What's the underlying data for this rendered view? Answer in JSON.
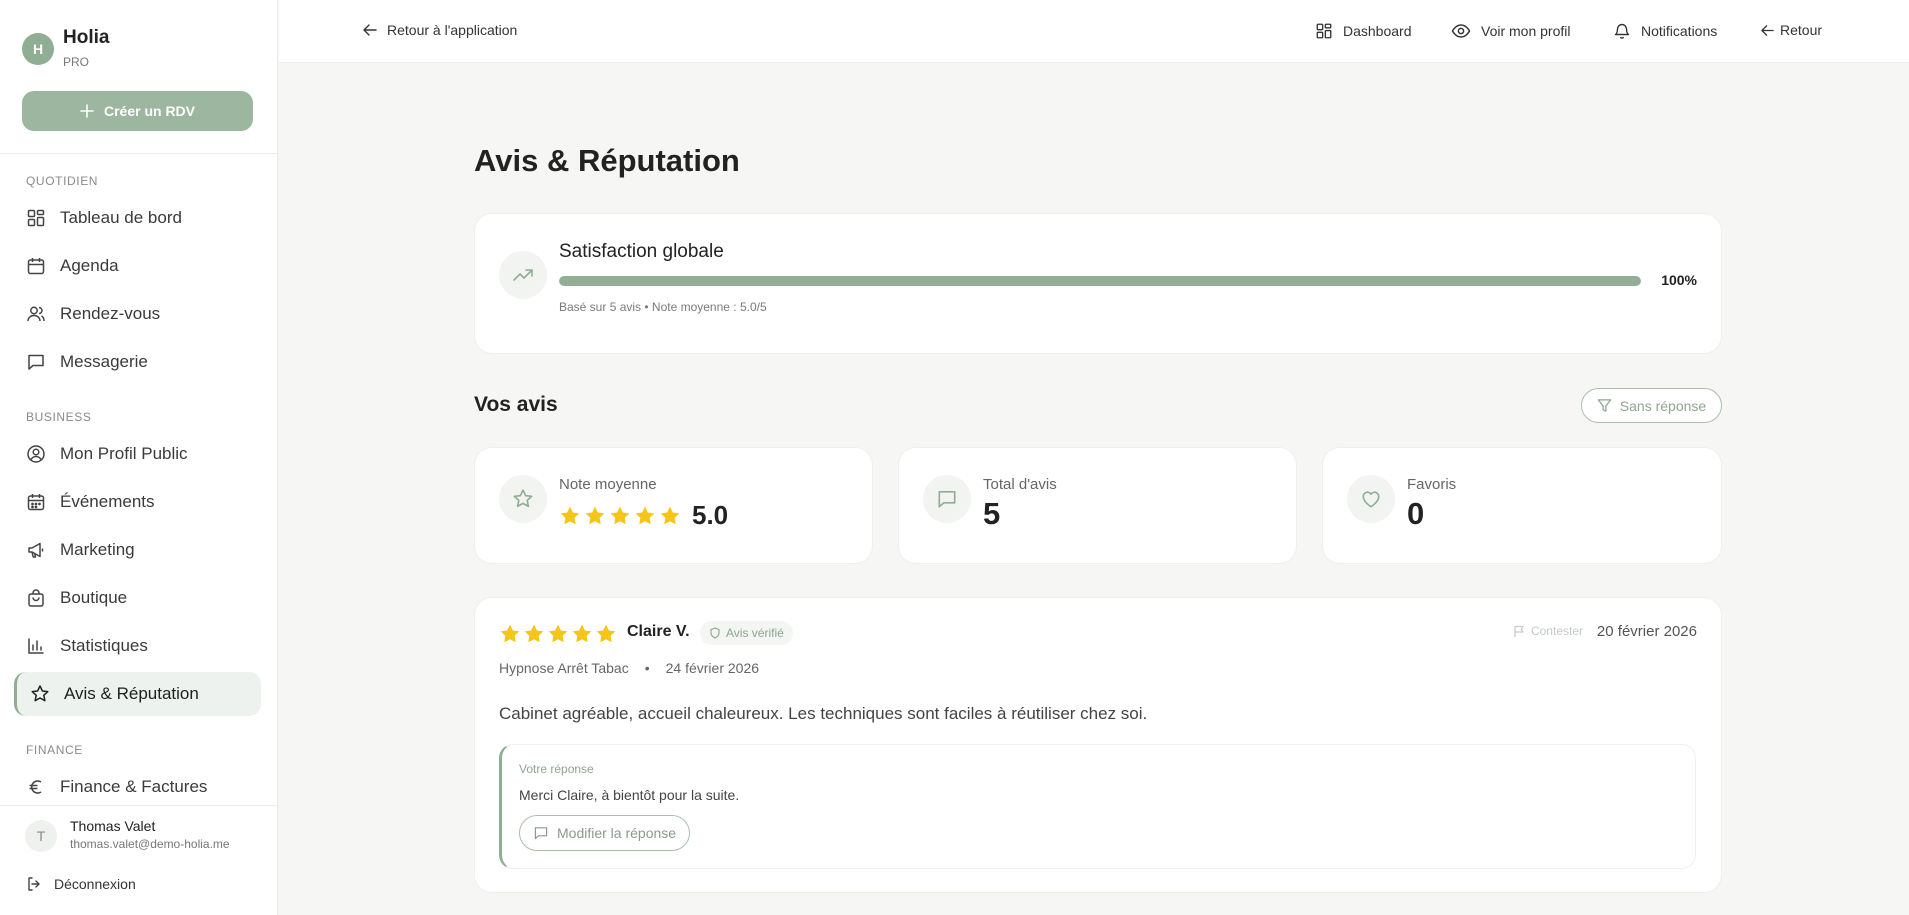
{
  "colors": {
    "accent": "#9db69f",
    "star": "#f5c518",
    "text": "#222222"
  },
  "sidebar": {
    "brand_initial": "H",
    "brand_name": "Holia",
    "brand_plan": "PRO",
    "create_label": "Créer un RDV",
    "sections": {
      "daily": "QUOTIDIEN",
      "business": "BUSINESS",
      "finance": "FINANCE"
    },
    "items": [
      {
        "label": "Tableau de bord",
        "icon": "grid-icon"
      },
      {
        "label": "Agenda",
        "icon": "calendar-icon"
      },
      {
        "label": "Rendez-vous",
        "icon": "users-icon"
      },
      {
        "label": "Messagerie",
        "icon": "message-icon"
      },
      {
        "label": "Mon Profil Public",
        "icon": "user-circle-icon"
      },
      {
        "label": "Événements",
        "icon": "calendar-days-icon"
      },
      {
        "label": "Marketing",
        "icon": "megaphone-icon"
      },
      {
        "label": "Boutique",
        "icon": "shopping-bag-icon"
      },
      {
        "label": "Statistiques",
        "icon": "bar-chart-icon"
      },
      {
        "label": "Avis & Réputation",
        "icon": "star-icon"
      },
      {
        "label": "Finance & Factures",
        "icon": "euro-icon"
      }
    ],
    "user": {
      "initial": "T",
      "name": "Thomas Valet",
      "email": "thomas.valet@demo-holia.me"
    },
    "logout_label": "Déconnexion"
  },
  "topbar": {
    "back_label": "Retour à l'application",
    "nav": [
      {
        "label": "Dashboard",
        "icon": "grid-icon"
      },
      {
        "label": "Voir mon profil",
        "icon": "eye-icon"
      },
      {
        "label": "Notifications",
        "icon": "bell-icon"
      },
      {
        "label": "Retour",
        "icon": "arrow-left-icon"
      }
    ]
  },
  "main": {
    "title": "Avis & Réputation",
    "satisfaction": {
      "title": "Satisfaction globale",
      "percent": 100,
      "percent_label": "100%",
      "subtitle": "Basé sur 5 avis • Note moyenne : 5.0/5"
    },
    "reviews_title": "Vos avis",
    "filter_label": "Sans réponse",
    "stats": {
      "average": {
        "label": "Note moyenne",
        "value": "5.0",
        "stars": 5
      },
      "total": {
        "label": "Total d'avis",
        "value": "5"
      },
      "favorites": {
        "label": "Favoris",
        "value": "0"
      }
    },
    "review": {
      "stars": 5,
      "author": "Claire V.",
      "verified_label": "Avis vérifié",
      "contest_label": "Contester",
      "date": "20 février 2026",
      "service": "Hypnose Arrêt Tabac",
      "bullet": "•",
      "session_date": "24 février 2026",
      "text": "Cabinet agréable, accueil chaleureux. Les techniques sont faciles à réutiliser chez soi.",
      "reply_label": "Votre réponse",
      "reply_text": "Merci Claire, à bientôt pour la suite.",
      "edit_label": "Modifier la réponse"
    }
  }
}
